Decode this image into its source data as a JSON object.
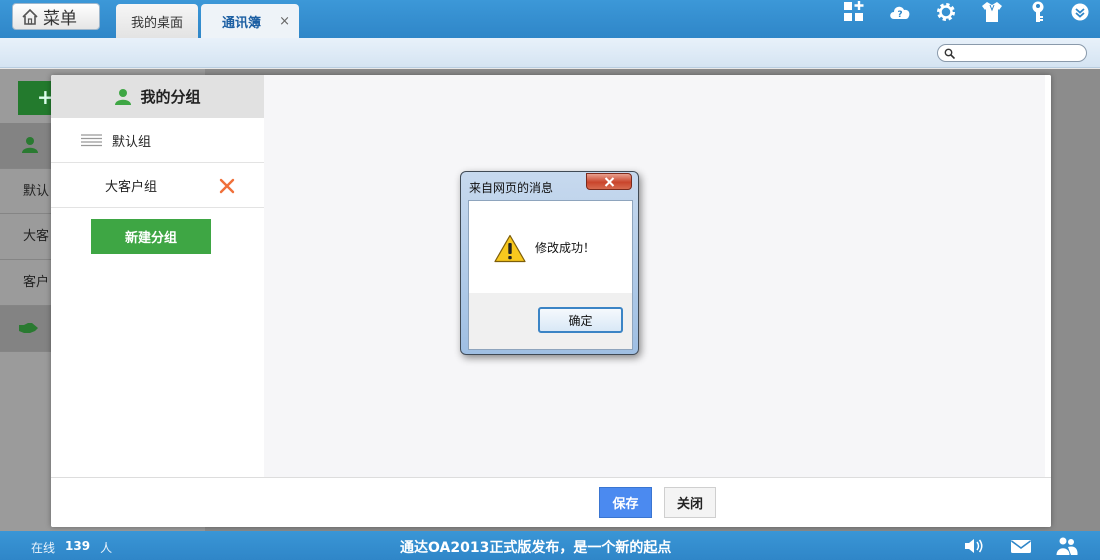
{
  "topbar": {
    "menu_label": "菜单",
    "tabs": [
      {
        "label": "我的桌面",
        "active": false
      },
      {
        "label": "通讯簿",
        "active": true,
        "close_glyph": "×"
      }
    ],
    "icons": [
      "add-shortcut-icon",
      "help-cloud-icon",
      "settings-gear-icon",
      "skin-shirt-icon",
      "key-icon",
      "collapse-chevron-icon"
    ]
  },
  "search": {
    "value": "",
    "placeholder": ""
  },
  "background": {
    "add_glyph": "+",
    "rows": [
      {
        "label": "默认",
        "kind": "item"
      },
      {
        "label": "大客",
        "kind": "item"
      },
      {
        "label": "客户",
        "kind": "item"
      }
    ]
  },
  "modal": {
    "group_title": "我的分组",
    "groups": [
      {
        "label": "默认组",
        "deletable": false
      },
      {
        "label": "大客户组",
        "deletable": true
      }
    ],
    "new_group_label": "新建分组",
    "save_label": "保存",
    "close_label": "关闭"
  },
  "alert": {
    "title": "来自网页的消息",
    "message": "修改成功！",
    "ok_label": "确定"
  },
  "statusbar": {
    "online_label": "在线",
    "online_count": "139",
    "online_unit": "人",
    "announcement": "通达OA2013正式版发布，是一个新的起点"
  },
  "colors": {
    "topbar_blue": "#2f86c8",
    "primary_green": "#3ea644",
    "save_blue": "#4b8af0",
    "delete_orange": "#f0703a"
  }
}
